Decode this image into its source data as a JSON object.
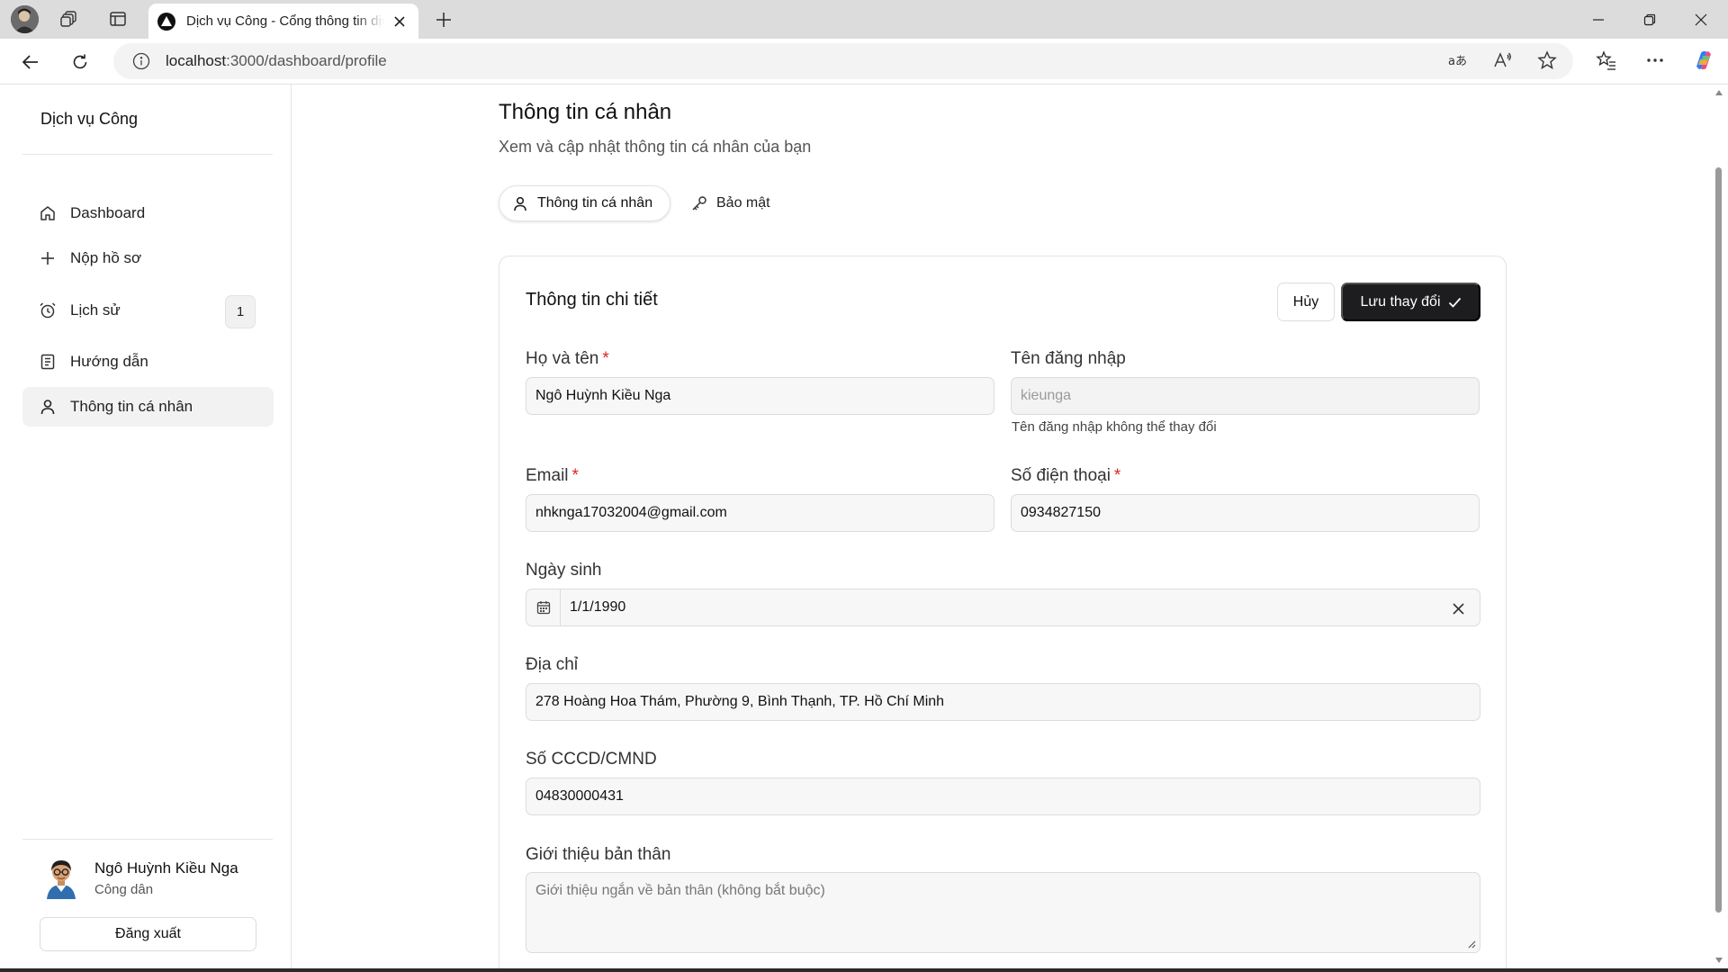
{
  "browser": {
    "tab_title": "Dịch vụ Công - Cổng thông tin dịch vụ công",
    "url_host": "localhost",
    "url_path": ":3000/dashboard/profile"
  },
  "sidebar": {
    "brand": "Dịch vụ Công",
    "items": [
      {
        "label": "Dashboard",
        "icon": "home-icon"
      },
      {
        "label": "Nộp hồ sơ",
        "icon": "plus-icon"
      },
      {
        "label": "Lịch sử",
        "icon": "alarm-clock-icon",
        "badge": "1"
      },
      {
        "label": "Hướng dẫn",
        "icon": "book-icon"
      },
      {
        "label": "Thông tin cá nhân",
        "icon": "user-icon",
        "active": true
      }
    ],
    "user": {
      "name": "Ngô Huỳnh Kiều Nga",
      "role": "Công dân"
    },
    "logout_label": "Đăng xuất"
  },
  "page": {
    "title": "Thông tin cá nhân",
    "subtitle": "Xem và cập nhật thông tin cá nhân của bạn",
    "tabs": [
      {
        "label": "Thông tin cá nhân",
        "icon": "user-icon",
        "active": true
      },
      {
        "label": "Bảo mật",
        "icon": "key-icon",
        "active": false
      }
    ]
  },
  "card": {
    "title": "Thông tin chi tiết",
    "cancel_label": "Hủy",
    "save_label": "Lưu thay đổi",
    "fields": {
      "fullname": {
        "label": "Họ và tên",
        "required": "*",
        "value": "Ngô Huỳnh Kiều Nga"
      },
      "username": {
        "label": "Tên đăng nhập",
        "value": "kieunga",
        "hint": "Tên đăng nhập không thể thay đổi"
      },
      "email": {
        "label": "Email",
        "required": "*",
        "value": "nhknga17032004@gmail.com"
      },
      "phone": {
        "label": "Số điện thoại",
        "required": "*",
        "value": "0934827150"
      },
      "birthday": {
        "label": "Ngày sinh",
        "value": "1/1/1990"
      },
      "address": {
        "label": "Địa chỉ",
        "value": "278 Hoàng Hoa Thám, Phường 9, Bình Thạnh, TP. Hồ Chí Minh"
      },
      "idcard": {
        "label": "Số CCCD/CMND",
        "value": "04830000431"
      },
      "bio": {
        "label": "Giới thiệu bản thân",
        "placeholder": "Giới thiệu ngắn về bản thân (không bắt buộc)"
      }
    }
  },
  "colors": {
    "primary_button": "#1d1d1f",
    "required": "#e02424",
    "active_nav_bg": "#f2f2f2"
  }
}
